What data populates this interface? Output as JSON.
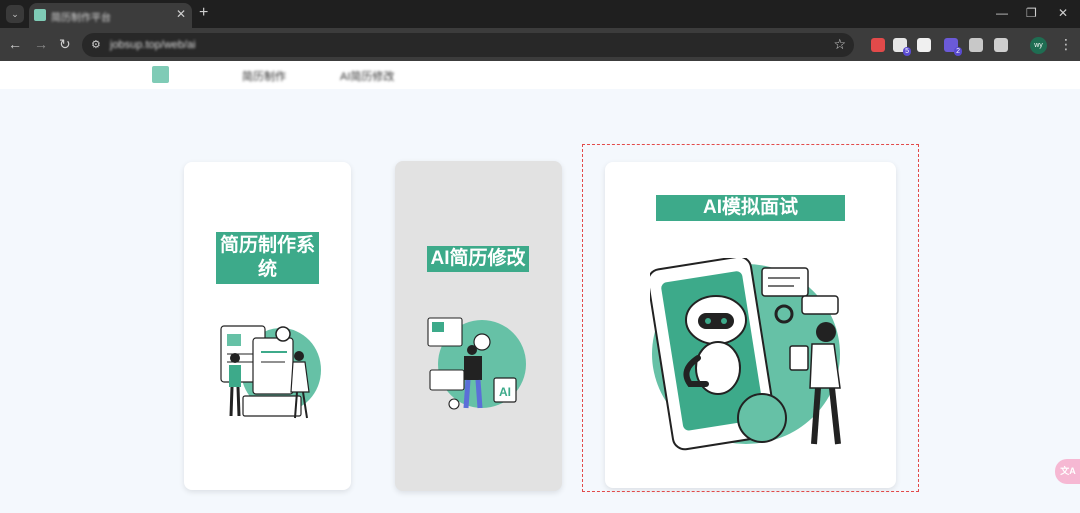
{
  "browser": {
    "tab_title": "简历制作平台",
    "url": "jobsup.top/web/ai",
    "tab_close": "✕",
    "new_tab": "+",
    "extensions": [
      {
        "name": "ext-1",
        "color": "#e24a4a",
        "badge": ""
      },
      {
        "name": "ext-2",
        "color": "#e6e6e6",
        "badge": "5"
      },
      {
        "name": "ext-3",
        "color": "#f0f0f0",
        "badge": ""
      },
      {
        "name": "ext-4",
        "color": "#6b5ad8",
        "badge": "2"
      },
      {
        "name": "ext-5",
        "color": "#c8c8c8",
        "badge": ""
      },
      {
        "name": "puzzle",
        "color": "#cfcfcf",
        "badge": ""
      }
    ],
    "avatar_initials": "wy"
  },
  "site": {
    "nav": [
      "简历制作",
      "AI简历修改"
    ]
  },
  "cards": [
    {
      "title": "简历制作系统",
      "selected": false
    },
    {
      "title": "AI简历修改",
      "selected": false
    },
    {
      "title": "AI模拟面试",
      "selected": true
    }
  ],
  "floating_button": "文A",
  "colors": {
    "accent": "#3daa8a",
    "accent_light": "#66c1a6",
    "selection_border": "#e24a4a",
    "page_bg": "#f4f8fd",
    "chrome_dark": "#1f1f1f"
  }
}
